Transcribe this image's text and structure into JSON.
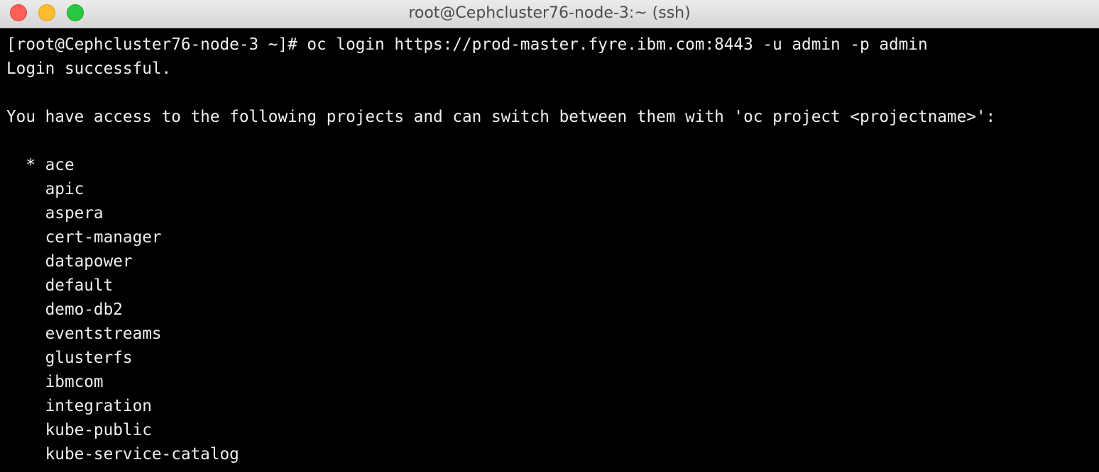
{
  "window": {
    "title": "root@Cephcluster76-node-3:~ (ssh)"
  },
  "terminal": {
    "lines": [
      "[root@Cephcluster76-node-3 ~]# oc login https://prod-master.fyre.ibm.com:8443 -u admin -p admin",
      "Login successful.",
      "",
      "You have access to the following projects and can switch between them with 'oc project <projectname>':",
      "",
      "  * ace",
      "    apic",
      "    aspera",
      "    cert-manager",
      "    datapower",
      "    default",
      "    demo-db2",
      "    eventstreams",
      "    glusterfs",
      "    ibmcom",
      "    integration",
      "    kube-public",
      "    kube-service-catalog"
    ]
  }
}
